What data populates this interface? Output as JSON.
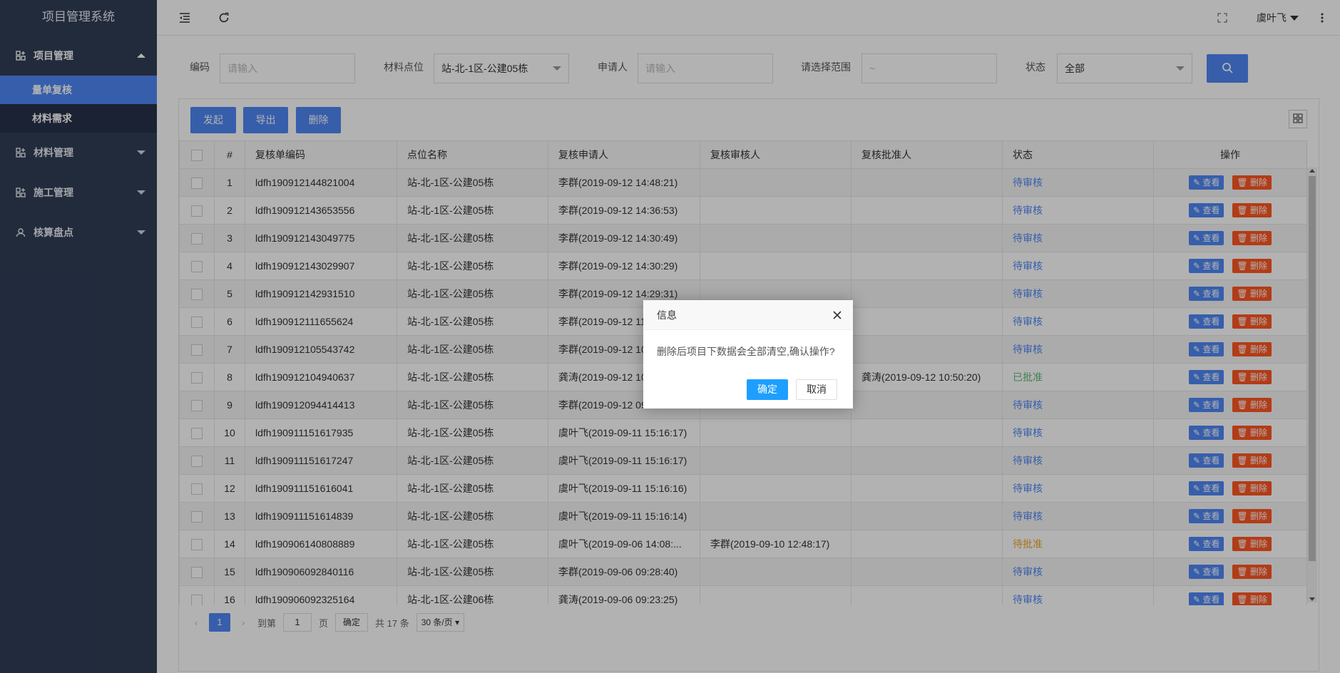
{
  "app": {
    "title": "项目管理系统"
  },
  "sidebar": {
    "groups": [
      {
        "label": "项目管理",
        "icon": "grid-plus-icon",
        "expanded": true,
        "items": [
          {
            "label": "量单复核",
            "active": true
          },
          {
            "label": "材料需求",
            "active": false
          }
        ]
      },
      {
        "label": "材料管理",
        "icon": "grid-plus-icon",
        "expanded": false
      },
      {
        "label": "施工管理",
        "icon": "grid-plus-icon",
        "expanded": false
      },
      {
        "label": "核算盘点",
        "icon": "user-icon",
        "expanded": false
      }
    ]
  },
  "header": {
    "user_name": "虞叶飞"
  },
  "filters": {
    "code_label": "编码",
    "code_placeholder": "请输入",
    "location_label": "材料点位",
    "location_value": "站-北-1区-公建05栋",
    "applicant_label": "申请人",
    "applicant_placeholder": "请输入",
    "range_label": "请选择范围",
    "range_placeholder": "~",
    "status_label": "状态",
    "status_value": "全部"
  },
  "toolbar": {
    "initiate": "发起",
    "export": "导出",
    "delete": "删除"
  },
  "table": {
    "headers": [
      "#",
      "复核单编码",
      "点位名称",
      "复核申请人",
      "复核审核人",
      "复核批准人",
      "状态",
      "操作"
    ],
    "view_label": "查看",
    "delete_label": "删除",
    "rows": [
      {
        "no": "1",
        "code": "ldfh190912144821004",
        "location": "站-北-1区-公建05栋",
        "applicant": "李群(2019-09-12 14:48:21)",
        "reviewer": "",
        "approver": "",
        "status": "待审核",
        "status_type": "pending"
      },
      {
        "no": "2",
        "code": "ldfh190912143653556",
        "location": "站-北-1区-公建05栋",
        "applicant": "李群(2019-09-12 14:36:53)",
        "reviewer": "",
        "approver": "",
        "status": "待审核",
        "status_type": "pending"
      },
      {
        "no": "3",
        "code": "ldfh190912143049775",
        "location": "站-北-1区-公建05栋",
        "applicant": "李群(2019-09-12 14:30:49)",
        "reviewer": "",
        "approver": "",
        "status": "待审核",
        "status_type": "pending"
      },
      {
        "no": "4",
        "code": "ldfh190912143029907",
        "location": "站-北-1区-公建05栋",
        "applicant": "李群(2019-09-12 14:30:29)",
        "reviewer": "",
        "approver": "",
        "status": "待审核",
        "status_type": "pending"
      },
      {
        "no": "5",
        "code": "ldfh190912142931510",
        "location": "站-北-1区-公建05栋",
        "applicant": "李群(2019-09-12 14:29:31)",
        "reviewer": "",
        "approver": "",
        "status": "待审核",
        "status_type": "pending"
      },
      {
        "no": "6",
        "code": "ldfh190912111655624",
        "location": "站-北-1区-公建05栋",
        "applicant": "李群(2019-09-12 11",
        "reviewer": "",
        "approver": "",
        "status": "待审核",
        "status_type": "pending"
      },
      {
        "no": "7",
        "code": "ldfh190912105543742",
        "location": "站-北-1区-公建05栋",
        "applicant": "李群(2019-09-12 10",
        "reviewer": "",
        "approver": "",
        "status": "待审核",
        "status_type": "pending"
      },
      {
        "no": "8",
        "code": "ldfh190912104940637",
        "location": "站-北-1区-公建05栋",
        "applicant": "龚涛(2019-09-12 10",
        "reviewer": "",
        "approver": "龚涛(2019-09-12 10:50:20)",
        "status": "已批准",
        "status_type": "approved"
      },
      {
        "no": "9",
        "code": "ldfh190912094414413",
        "location": "站-北-1区-公建05栋",
        "applicant": "李群(2019-09-12 09",
        "reviewer": "",
        "approver": "",
        "status": "待审核",
        "status_type": "pending"
      },
      {
        "no": "10",
        "code": "ldfh190911151617935",
        "location": "站-北-1区-公建05栋",
        "applicant": "虞叶飞(2019-09-11 15:16:17)",
        "reviewer": "",
        "approver": "",
        "status": "待审核",
        "status_type": "pending"
      },
      {
        "no": "11",
        "code": "ldfh190911151617247",
        "location": "站-北-1区-公建05栋",
        "applicant": "虞叶飞(2019-09-11 15:16:17)",
        "reviewer": "",
        "approver": "",
        "status": "待审核",
        "status_type": "pending"
      },
      {
        "no": "12",
        "code": "ldfh190911151616041",
        "location": "站-北-1区-公建05栋",
        "applicant": "虞叶飞(2019-09-11 15:16:16)",
        "reviewer": "",
        "approver": "",
        "status": "待审核",
        "status_type": "pending"
      },
      {
        "no": "13",
        "code": "ldfh190911151614839",
        "location": "站-北-1区-公建05栋",
        "applicant": "虞叶飞(2019-09-11 15:16:14)",
        "reviewer": "",
        "approver": "",
        "status": "待审核",
        "status_type": "pending"
      },
      {
        "no": "14",
        "code": "ldfh190906140808889",
        "location": "站-北-1区-公建05栋",
        "applicant": "虞叶飞(2019-09-06 14:08:...",
        "reviewer": "李群(2019-09-10 12:48:17)",
        "approver": "",
        "status": "待批准",
        "status_type": "wait"
      },
      {
        "no": "15",
        "code": "ldfh190906092840116",
        "location": "站-北-1区-公建05栋",
        "applicant": "李群(2019-09-06 09:28:40)",
        "reviewer": "",
        "approver": "",
        "status": "待审核",
        "status_type": "pending"
      },
      {
        "no": "16",
        "code": "ldfh190906092325164",
        "location": "站-北-1区-公建06栋",
        "applicant": "龚涛(2019-09-06 09:23:25)",
        "reviewer": "",
        "approver": "",
        "status": "待审核",
        "status_type": "pending"
      }
    ]
  },
  "pagination": {
    "current_page": "1",
    "goto_label": "到第",
    "goto_value": "1",
    "page_label": "页",
    "confirm_label": "确定",
    "total_label": "共 17 条",
    "page_size": "30 条/页"
  },
  "dialog": {
    "title": "信息",
    "message": "删除后项目下数据会全部清空,确认操作?",
    "ok_label": "确定",
    "cancel_label": "取消"
  },
  "colors": {
    "sidebar": "#313e57",
    "primary": "#4f87f5",
    "danger": "#ff5722",
    "approved": "#5fb878",
    "wait": "#f0a62d",
    "dialog_ok": "#1e9fff"
  }
}
